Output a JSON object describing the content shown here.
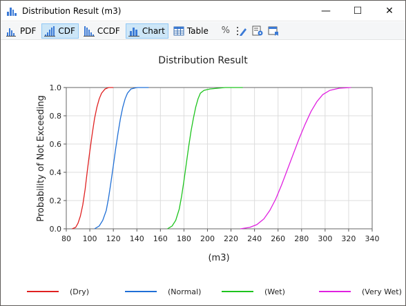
{
  "window": {
    "title": "Distribution Result (m3)",
    "minimize_symbol": "—",
    "maximize_symbol": "☐",
    "close_symbol": "✕"
  },
  "toolbar": {
    "pdf_label": "PDF",
    "cdf_label": "CDF",
    "ccdf_label": "CCDF",
    "chart_label": "Chart",
    "table_label": "Table",
    "percent_symbol": "%"
  },
  "colors": {
    "dry": "#e02020",
    "normal": "#1f6fd6",
    "wet": "#1dc41d",
    "very_wet": "#e020e0",
    "grid": "#dcdcdc",
    "accent": "#3b7ad6"
  },
  "chart_data": {
    "type": "line",
    "title": "Distribution Result",
    "xlabel": "(m3)",
    "ylabel": "Probability of Not Exceeding",
    "xlim": [
      80,
      340
    ],
    "ylim": [
      0,
      1
    ],
    "xticks": [
      "80",
      "100",
      "120",
      "140",
      "160",
      "180",
      "200",
      "220",
      "240",
      "260",
      "280",
      "300",
      "320",
      "340"
    ],
    "yticks": [
      "0.0",
      "0.2",
      "0.4",
      "0.6",
      "0.8",
      "1.0"
    ],
    "grid": true,
    "legend_position": "bottom",
    "series": [
      {
        "name": "(Dry)",
        "color": "#e02020",
        "x": [
          85,
          88,
          90,
          92,
          94,
          96,
          98,
          100,
          102,
          104,
          106,
          108,
          110,
          113,
          116,
          120
        ],
        "y": [
          0.0,
          0.01,
          0.04,
          0.09,
          0.17,
          0.28,
          0.42,
          0.55,
          0.67,
          0.78,
          0.86,
          0.92,
          0.96,
          0.99,
          1.0,
          1.0
        ]
      },
      {
        "name": "(Normal)",
        "color": "#1f6fd6",
        "x": [
          104,
          108,
          111,
          114,
          116,
          118,
          120,
          122,
          124,
          126,
          128,
          130,
          132,
          135,
          140,
          150
        ],
        "y": [
          0.0,
          0.02,
          0.06,
          0.13,
          0.22,
          0.33,
          0.45,
          0.57,
          0.68,
          0.78,
          0.86,
          0.92,
          0.96,
          0.99,
          1.0,
          1.0
        ]
      },
      {
        "name": "(Wet)",
        "color": "#1dc41d",
        "x": [
          166,
          170,
          173,
          176,
          178,
          180,
          182,
          184,
          186,
          188,
          190,
          192,
          194,
          197,
          202,
          215,
          230
        ],
        "y": [
          0.0,
          0.02,
          0.06,
          0.14,
          0.23,
          0.34,
          0.46,
          0.58,
          0.69,
          0.78,
          0.86,
          0.92,
          0.96,
          0.98,
          0.99,
          1.0,
          1.0
        ]
      },
      {
        "name": "(Very Wet)",
        "color": "#e020e0",
        "x": [
          228,
          236,
          242,
          248,
          253,
          258,
          263,
          268,
          273,
          278,
          283,
          288,
          293,
          298,
          304,
          312,
          322
        ],
        "y": [
          0.0,
          0.01,
          0.03,
          0.07,
          0.13,
          0.21,
          0.31,
          0.42,
          0.53,
          0.64,
          0.74,
          0.83,
          0.9,
          0.95,
          0.98,
          0.995,
          1.0
        ]
      }
    ]
  }
}
